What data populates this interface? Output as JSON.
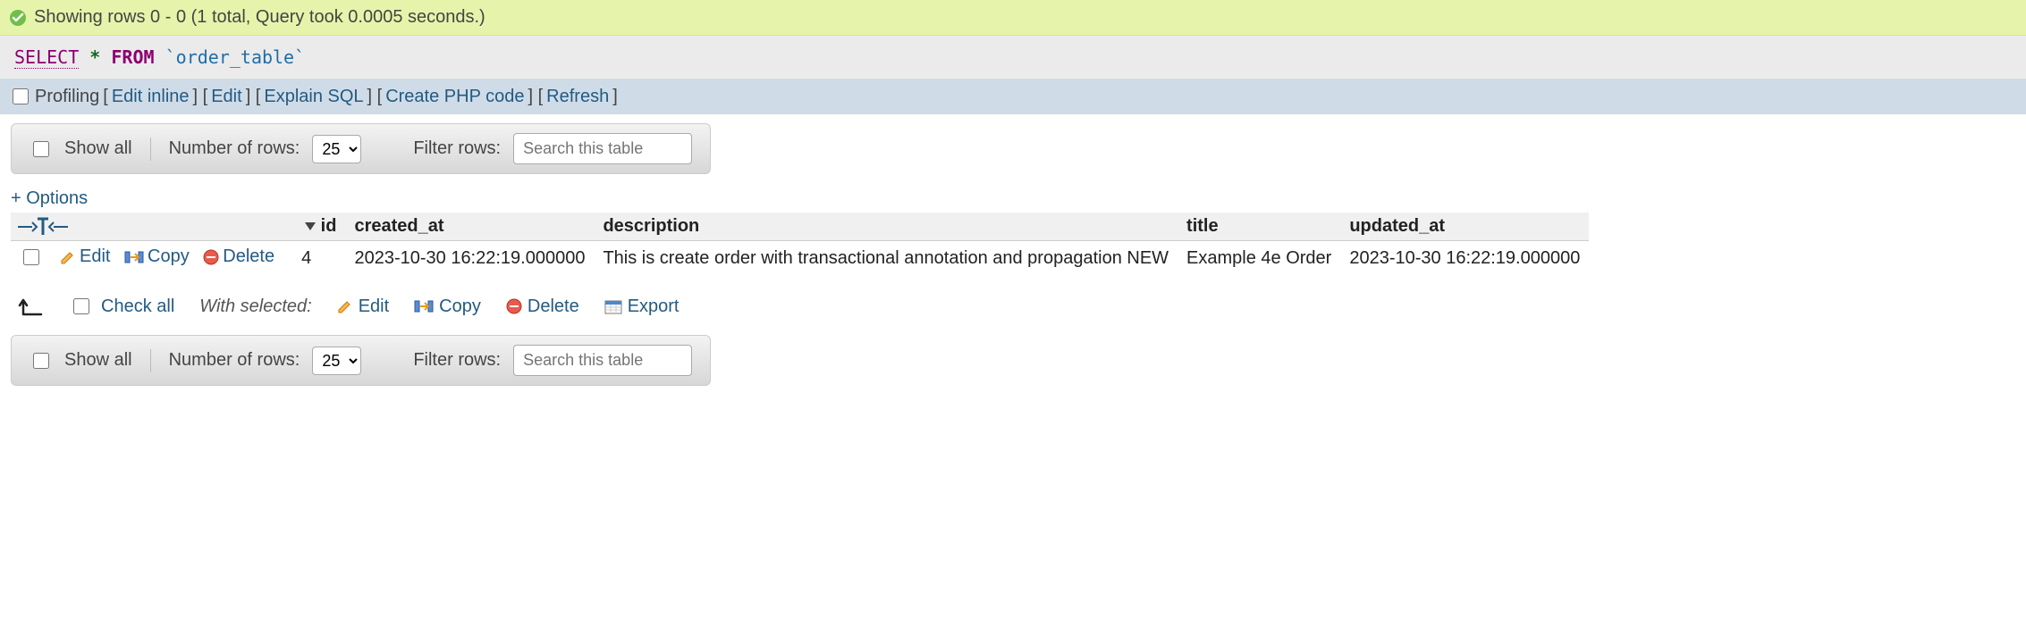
{
  "status": {
    "message": "Showing rows 0 - 0 (1 total, Query took 0.0005 seconds.)"
  },
  "sql": {
    "select": "SELECT",
    "star": "*",
    "from": "FROM",
    "identifier": "`order_table`"
  },
  "tools": {
    "profiling": "Profiling",
    "edit_inline": "Edit inline",
    "edit": "Edit",
    "explain": "Explain SQL",
    "create_php": "Create PHP code",
    "refresh": "Refresh"
  },
  "toolbar": {
    "show_all": "Show all",
    "num_rows_label": "Number of rows:",
    "num_rows_value": "25",
    "filter_label": "Filter rows:",
    "filter_placeholder": "Search this table"
  },
  "options_link": "+ Options",
  "columns": {
    "id": "id",
    "created_at": "created_at",
    "description": "description",
    "title": "title",
    "updated_at": "updated_at"
  },
  "row_actions": {
    "edit": "Edit",
    "copy": "Copy",
    "delete": "Delete"
  },
  "rows": [
    {
      "id": "4",
      "created_at": "2023-10-30 16:22:19.000000",
      "description": "This is create order with transactional annotation and propagation NEW",
      "title": "Example 4e Order",
      "updated_at": "2023-10-30 16:22:19.000000"
    }
  ],
  "bulk": {
    "check_all": "Check all",
    "with_selected": "With selected:",
    "edit": "Edit",
    "copy": "Copy",
    "delete": "Delete",
    "export": "Export"
  }
}
